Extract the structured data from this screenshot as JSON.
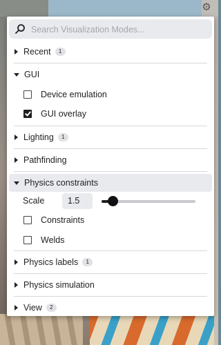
{
  "toolbar": {
    "gear_icon": "gear-icon"
  },
  "search": {
    "placeholder": "Search Visualization Modes..."
  },
  "sections": {
    "recent": {
      "label": "Recent",
      "badge": "1",
      "expanded": false
    },
    "gui": {
      "label": "GUI",
      "expanded": true,
      "options": [
        {
          "label": "Device emulation",
          "checked": false
        },
        {
          "label": "GUI overlay",
          "checked": true
        }
      ]
    },
    "lighting": {
      "label": "Lighting",
      "badge": "1",
      "expanded": false
    },
    "pathfinding": {
      "label": "Pathfinding",
      "expanded": false
    },
    "physics_constraints": {
      "label": "Physics constraints",
      "expanded": true,
      "scale_label": "Scale",
      "scale_value": "1.5",
      "slider_level": 0.12,
      "options": [
        {
          "label": "Constraints",
          "checked": false
        },
        {
          "label": "Welds",
          "checked": false
        }
      ]
    },
    "physics_labels": {
      "label": "Physics labels",
      "badge": "1",
      "expanded": false
    },
    "physics_simulation": {
      "label": "Physics simulation",
      "expanded": false
    },
    "view": {
      "label": "View",
      "badge": "2",
      "expanded": false
    }
  },
  "colors": {
    "panel_bg": "#ffffff",
    "search_bg": "#e9eaee",
    "accent": "#1f1f1f"
  }
}
